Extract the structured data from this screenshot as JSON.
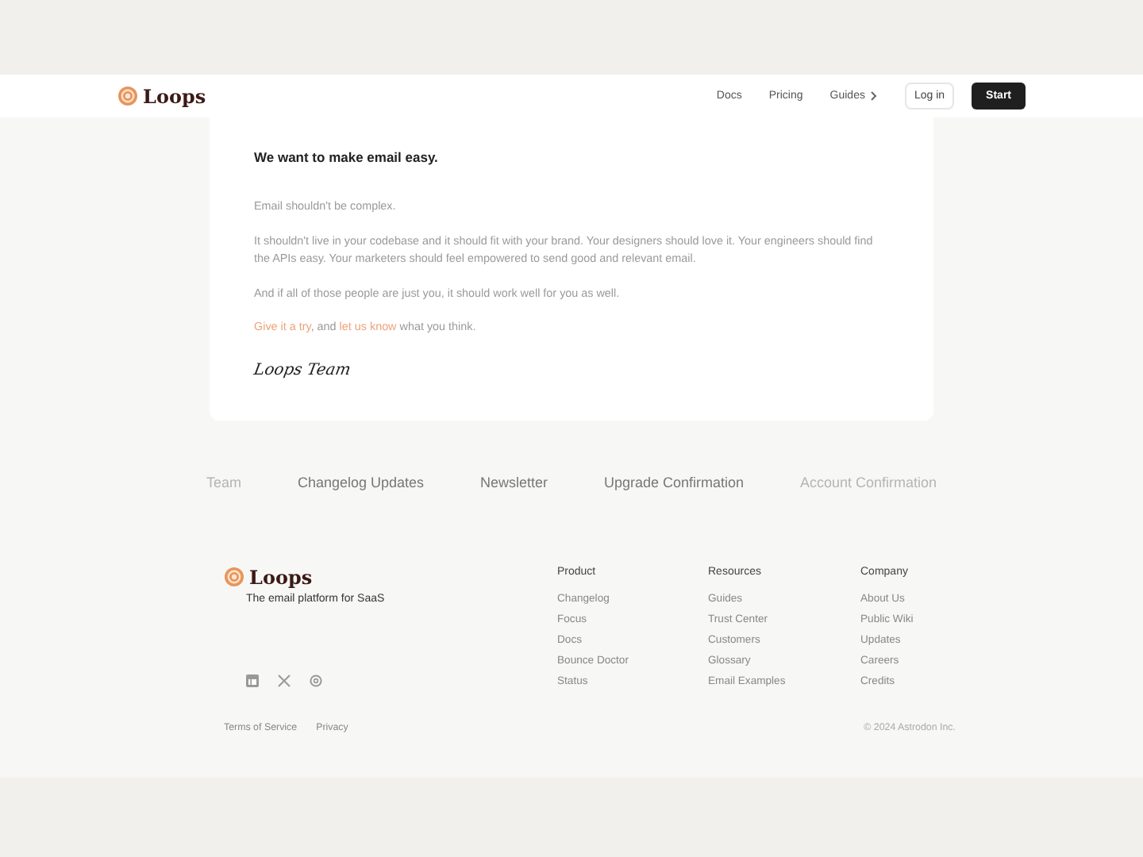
{
  "header": {
    "logo": "Loops",
    "nav": [
      {
        "label": "Docs",
        "kind": "link"
      },
      {
        "label": "Pricing",
        "kind": "link"
      },
      {
        "label": "Guides",
        "kind": "menu"
      }
    ],
    "login": "Log in",
    "start": "Start"
  },
  "letter": {
    "heading": "We want to make email easy.",
    "paragraphs": [
      "Email shouldn't be complex.",
      "It shouldn't live in your codebase and it should fit with your brand. Your designers should love it. Your engineers should find the APIs easy. Your marketers should feel empowered to send good and relevant email.",
      "And if all of those people are just you, it should work well for you as well."
    ],
    "closing": [
      {
        "text": "Give it a try",
        "kind": "link"
      },
      {
        "text": ", and ",
        "kind": "text"
      },
      {
        "text": "let us know",
        "kind": "link"
      },
      {
        "text": " what you think.",
        "kind": "text"
      }
    ],
    "signature": "Loops Team"
  },
  "templates": [
    {
      "label": "Team",
      "faded": true
    },
    {
      "label": "Changelog Updates",
      "faded": false
    },
    {
      "label": "Newsletter",
      "faded": false
    },
    {
      "label": "Upgrade Confirmation",
      "faded": false
    },
    {
      "label": "Account Confirmation",
      "faded": true
    }
  ],
  "footer": {
    "logo": "Loops",
    "tagline": "The email platform for SaaS",
    "columns": [
      {
        "title": "Product",
        "links": [
          "Changelog",
          "Focus",
          "Docs",
          "Bounce Doctor",
          "Status"
        ]
      },
      {
        "title": "Resources",
        "links": [
          "Guides",
          "Trust Center",
          "Customers",
          "Glossary",
          "Email Examples"
        ]
      },
      {
        "title": "Company",
        "links": [
          "About Us",
          "Public Wiki",
          "Updates",
          "Careers",
          "Credits"
        ]
      }
    ],
    "legal": [
      "Terms of Service",
      "Privacy"
    ],
    "copyright": "© 2024 Astrodon Inc."
  }
}
